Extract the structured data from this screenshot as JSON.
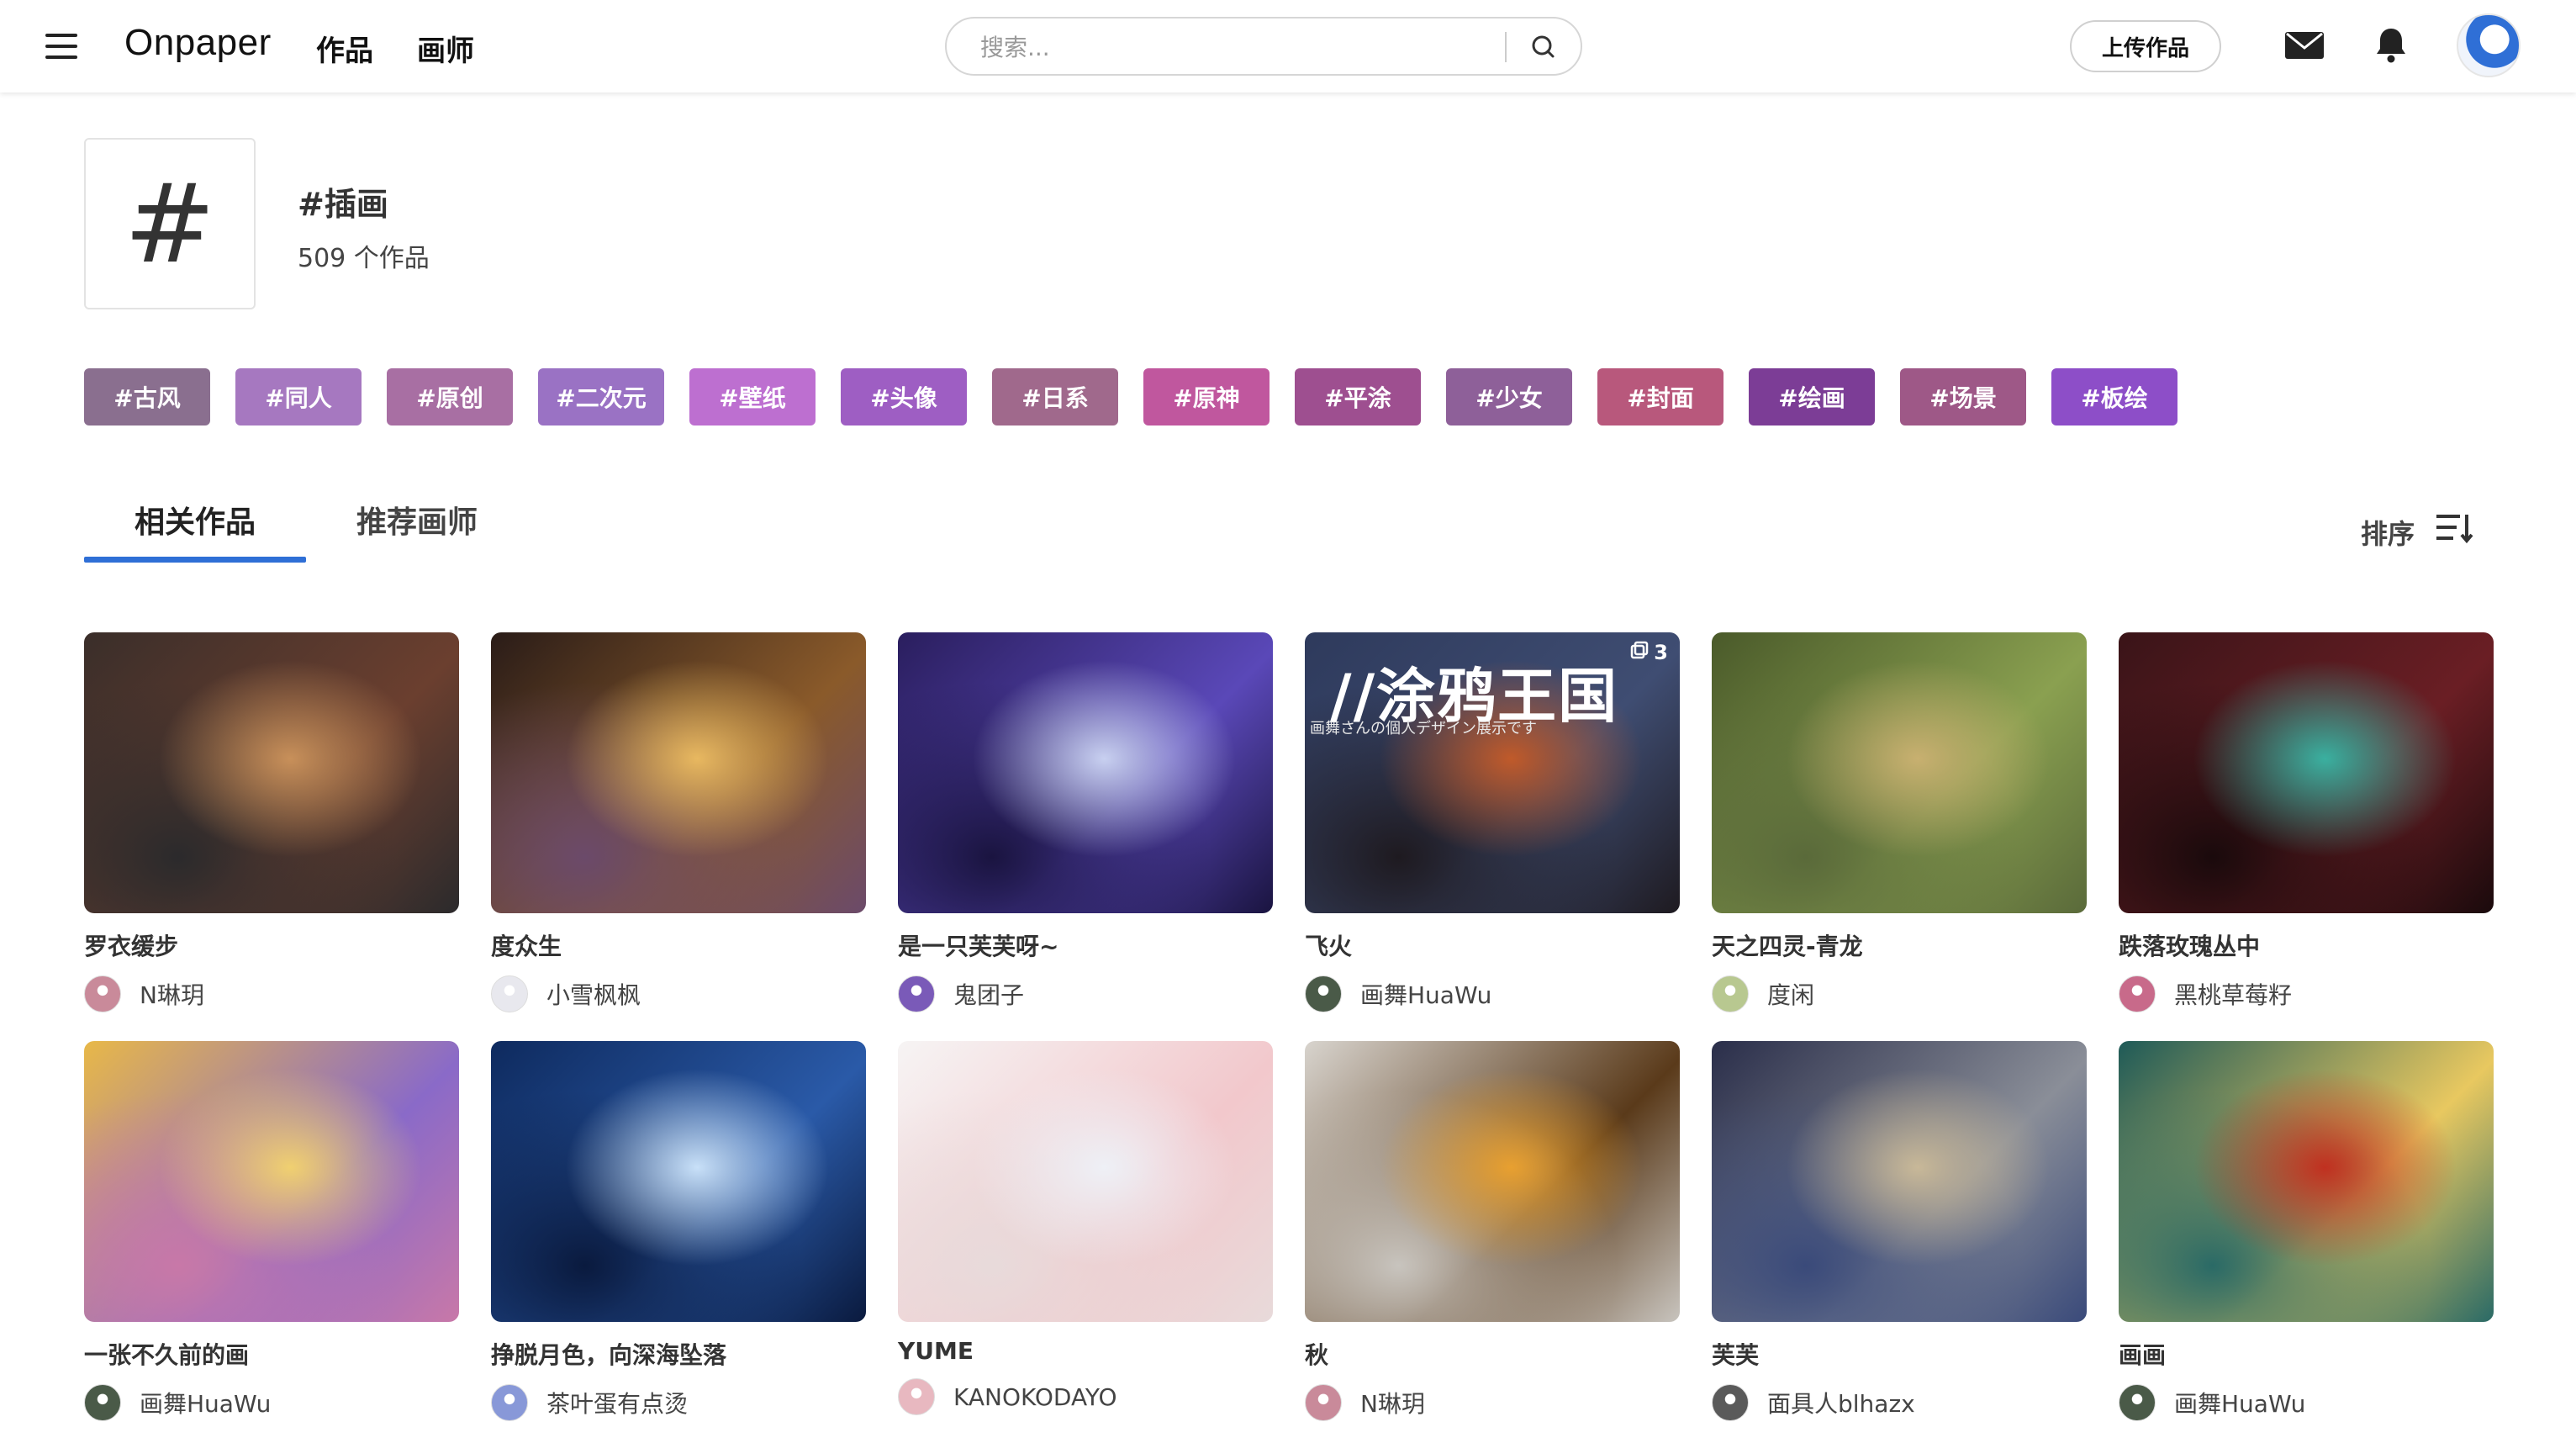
{
  "header": {
    "logo": "Onpaper",
    "nav": [
      "作品",
      "画师"
    ],
    "search_placeholder": "搜索...",
    "upload_label": "上传作品",
    "icons": [
      "menu-icon",
      "search-icon",
      "mail-icon",
      "bell-icon"
    ]
  },
  "tag": {
    "symbol": "#",
    "title": "#插画",
    "count": "509  个作品"
  },
  "chips": [
    {
      "label": "#古风",
      "color": "#8a6f8f"
    },
    {
      "label": "#同人",
      "color": "#a678c0"
    },
    {
      "label": "#原创",
      "color": "#a86fa3"
    },
    {
      "label": "#二次元",
      "color": "#9a72c4"
    },
    {
      "label": "#壁纸",
      "color": "#bd6fd0"
    },
    {
      "label": "#头像",
      "color": "#9e5ec3"
    },
    {
      "label": "#日系",
      "color": "#a0698c"
    },
    {
      "label": "#原神",
      "color": "#c0579e"
    },
    {
      "label": "#平涂",
      "color": "#9e4f90"
    },
    {
      "label": "#少女",
      "color": "#8e6099"
    },
    {
      "label": "#封面",
      "color": "#b8587c"
    },
    {
      "label": "#绘画",
      "color": "#7c3d96"
    },
    {
      "label": "#场景",
      "color": "#9e5887"
    },
    {
      "label": "#板绘",
      "color": "#8d4ec8"
    }
  ],
  "tabs": [
    "相关作品",
    "推荐画师"
  ],
  "sort_label": "排序",
  "works": [
    {
      "title": "罗衣缓步",
      "author": "N琳玥",
      "colors": [
        "#3a2e2a",
        "#6b3f2f",
        "#c8905a",
        "#2b2a2c"
      ],
      "avatar": "#c98a9a"
    },
    {
      "title": "度众生",
      "author": "小雪枫枫",
      "colors": [
        "#2a1c18",
        "#8a5a2a",
        "#e8b860",
        "#6b4a6a"
      ],
      "avatar": "#e8e8ee"
    },
    {
      "title": "是一只芙芙呀~",
      "author": "鬼团子",
      "colors": [
        "#2a1e5e",
        "#5a48b8",
        "#c8d0f0",
        "#1a1440"
      ],
      "avatar": "#7a5ab8"
    },
    {
      "title": "飞火",
      "author": "画舞HuaWu",
      "colors": [
        "#2e3a5c",
        "#3f4d72",
        "#c05a2a",
        "#1e1a20"
      ],
      "avatar": "#4a5a48",
      "badge": "3",
      "overlay": "//涂鸦王国",
      "overlay_sub": "画舞さんの個人デザイン展示です"
    },
    {
      "title": "天之四灵-青龙",
      "author": "度闲",
      "colors": [
        "#4a5a2a",
        "#8aa050",
        "#c8b070",
        "#5a6a3a"
      ],
      "avatar": "#b8c890"
    },
    {
      "title": "跌落玫瑰丛中",
      "author": "黑桃草莓籽",
      "colors": [
        "#3a1418",
        "#6a1e24",
        "#3ab0a0",
        "#1a0a0c"
      ],
      "avatar": "#c86a8a"
    },
    {
      "title": "一张不久前的画",
      "author": "画舞HuaWu",
      "colors": [
        "#e8b848",
        "#8a6ac8",
        "#f0d070",
        "#c878a8"
      ],
      "avatar": "#4a5a48"
    },
    {
      "title": "挣脱月色，向深海坠落",
      "author": "茶叶蛋有点烫",
      "colors": [
        "#0e2a5e",
        "#2a5aa8",
        "#c8e0f8",
        "#0a1a3e"
      ],
      "avatar": "#8898d8"
    },
    {
      "title": "YUME",
      "author": "KANOKODAYO",
      "colors": [
        "#f6f4f4",
        "#f2c8cc",
        "#eef0f6",
        "#e8dada"
      ],
      "avatar": "#e8b8c0"
    },
    {
      "title": "秋",
      "author": "N琳玥",
      "colors": [
        "#d8d4ce",
        "#5a3a1a",
        "#e8a030",
        "#c8c4be"
      ],
      "avatar": "#c98a9a"
    },
    {
      "title": "芙芙",
      "author": "面具人blhazx",
      "colors": [
        "#2a2e4a",
        "#8a8e98",
        "#c8b898",
        "#3a4a7a"
      ],
      "avatar": "#5a5a5a"
    },
    {
      "title": "画画",
      "author": "画舞HuaWu",
      "colors": [
        "#1e5a58",
        "#e8c860",
        "#c03020",
        "#2a6a66"
      ],
      "avatar": "#4a5a48"
    }
  ]
}
